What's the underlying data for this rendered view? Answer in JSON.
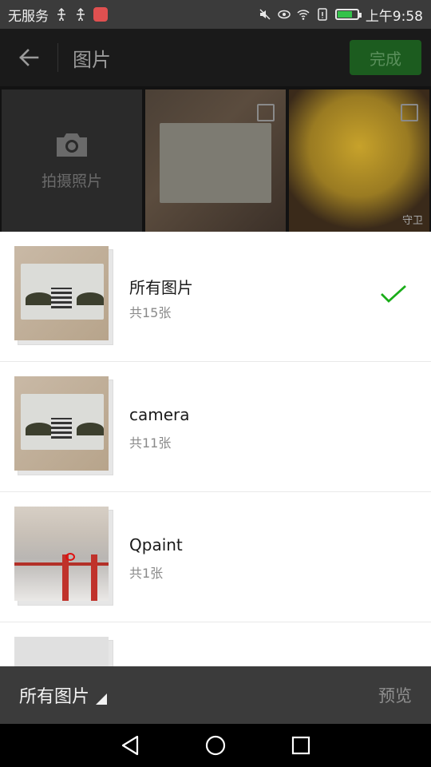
{
  "status_bar": {
    "carrier": "无服务",
    "time": "上午9:58",
    "icons": [
      "usb-icon",
      "usb-icon",
      "app-icon",
      "mute-icon",
      "eye-icon",
      "wifi-icon",
      "sim-icon",
      "battery-icon"
    ]
  },
  "header": {
    "title": "图片",
    "done_label": "完成"
  },
  "grid": {
    "camera_label": "拍摄照片",
    "tile_tag": "守卫"
  },
  "albums": [
    {
      "name": "所有图片",
      "count": "共15张",
      "selected": true
    },
    {
      "name": "camera",
      "count": "共11张",
      "selected": false
    },
    {
      "name": "Qpaint",
      "count": "共1张",
      "selected": false
    },
    {
      "name": "",
      "count": "",
      "selected": false
    }
  ],
  "bottom_bar": {
    "folder_label": "所有图片",
    "preview_label": "预览"
  },
  "colors": {
    "accent_green": "#1aad19",
    "header_bg": "#1a1a1a",
    "bar_bg": "#3b3b3b"
  }
}
